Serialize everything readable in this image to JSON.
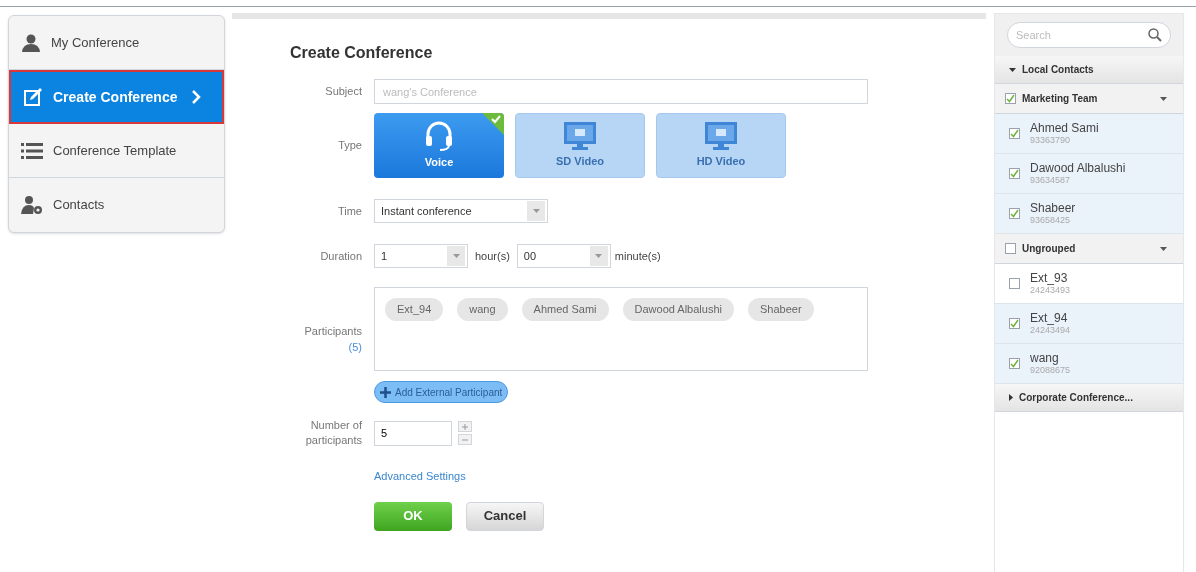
{
  "nav": [
    {
      "label": "My Conference",
      "kind": "person",
      "selected": false
    },
    {
      "label": "Create Conference",
      "kind": "edit",
      "selected": true
    },
    {
      "label": "Conference Template",
      "kind": "list",
      "selected": false
    },
    {
      "label": "Contacts",
      "kind": "contacts",
      "selected": false
    }
  ],
  "form": {
    "title": "Create Conference",
    "subject": {
      "label": "Subject",
      "placeholder": "wang's Conference"
    },
    "type": {
      "label": "Type",
      "options": [
        {
          "label": "Voice",
          "kind": "headset",
          "selected": true
        },
        {
          "label": "SD Video",
          "kind": "monitor",
          "selected": false
        },
        {
          "label": "HD Video",
          "kind": "monitor",
          "selected": false
        }
      ]
    },
    "time": {
      "label": "Time",
      "value": "Instant conference"
    },
    "duration": {
      "label": "Duration",
      "hours": "1",
      "hours_unit": "hour(s)",
      "minutes": "00",
      "minutes_unit": "minute(s)"
    },
    "participants": {
      "label": "Participants",
      "count": "(5)",
      "chips": [
        "Ext_94",
        "wang",
        "Ahmed Sami",
        "Dawood Albalushi",
        "Shabeer"
      ]
    },
    "add_button": "Add External Participant",
    "number": {
      "label": "Number of participants",
      "value": "5"
    },
    "advanced_link": "Advanced Settings",
    "buttons": {
      "ok": "OK",
      "cancel": "Cancel"
    }
  },
  "contacts": {
    "search_placeholder": "Search",
    "sections": [
      {
        "name": "Local Contacts",
        "expanded": true,
        "groups": [
          {
            "name": "Marketing Team",
            "checked": true,
            "children": [
              {
                "name": "Ahmed Sami",
                "number": "93363790",
                "checked": true
              },
              {
                "name": "Dawood Albalushi",
                "number": "93634587",
                "checked": true
              },
              {
                "name": "Shabeer",
                "number": "93658425",
                "checked": true
              }
            ]
          },
          {
            "name": "Ungrouped",
            "checked": false,
            "children": [
              {
                "name": "Ext_93",
                "number": "24243493",
                "checked": false
              },
              {
                "name": "Ext_94",
                "number": "24243494",
                "checked": true
              },
              {
                "name": "wang",
                "number": "92088675",
                "checked": true
              }
            ]
          }
        ]
      },
      {
        "name": "Corporate Conference...",
        "expanded": false
      }
    ]
  }
}
